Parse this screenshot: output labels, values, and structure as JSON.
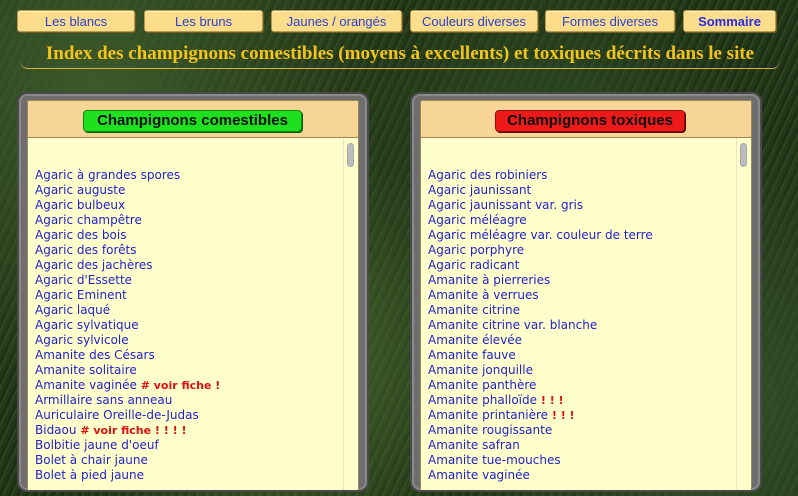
{
  "nav": {
    "tabs": [
      {
        "label": "Les blancs"
      },
      {
        "label": "Les bruns"
      },
      {
        "label": "Jaunes / orangés"
      },
      {
        "label": "Couleurs diverses"
      },
      {
        "label": "Formes diverses"
      },
      {
        "label": "Sommaire"
      }
    ]
  },
  "title": "Index des champignons comestibles (moyens à excellents) et toxiques décrits dans le site",
  "colors": {
    "accent_title": "#f2c418",
    "link": "#2222cc",
    "edible_button": "#1ee01e",
    "toxic_button": "#ee1a1a",
    "warning": "#e01010"
  },
  "edible": {
    "heading": "Champignons comestibles",
    "items": [
      {
        "name": "Agaric à grandes spores",
        "note": ""
      },
      {
        "name": "Agaric auguste",
        "note": ""
      },
      {
        "name": "Agaric bulbeux",
        "note": ""
      },
      {
        "name": "Agaric champêtre",
        "note": ""
      },
      {
        "name": "Agaric des bois",
        "note": ""
      },
      {
        "name": "Agaric des forêts",
        "note": ""
      },
      {
        "name": "Agaric des jachères",
        "note": ""
      },
      {
        "name": "Agaric d'Essette",
        "note": ""
      },
      {
        "name": "Agaric Eminent",
        "note": ""
      },
      {
        "name": "Agaric laqué",
        "note": ""
      },
      {
        "name": "Agaric sylvatique",
        "note": ""
      },
      {
        "name": "Agaric sylvicole",
        "note": ""
      },
      {
        "name": "Amanite des Césars",
        "note": ""
      },
      {
        "name": "Amanite solitaire",
        "note": ""
      },
      {
        "name": "Amanite vaginée",
        "note": "# voir fiche !"
      },
      {
        "name": "Armillaire sans anneau",
        "note": ""
      },
      {
        "name": "Auriculaire Oreille-de-Judas",
        "note": ""
      },
      {
        "name": "Bidaou",
        "note": "# voir fiche !   ! ! !"
      },
      {
        "name": "Bolbitie jaune d'oeuf",
        "note": ""
      },
      {
        "name": "Bolet à chair jaune",
        "note": ""
      },
      {
        "name": "Bolet à pied jaune",
        "note": ""
      }
    ]
  },
  "toxic": {
    "heading": "Champignons toxiques",
    "items": [
      {
        "name": "Agaric des robiniers",
        "note": ""
      },
      {
        "name": "Agaric jaunissant",
        "note": ""
      },
      {
        "name": "Agaric jaunissant var. gris",
        "note": ""
      },
      {
        "name": "Agaric méléagre",
        "note": ""
      },
      {
        "name": "Agaric méléagre var. couleur de terre",
        "note": ""
      },
      {
        "name": "Agaric porphyre",
        "note": ""
      },
      {
        "name": "Agaric radicant",
        "note": ""
      },
      {
        "name": "Amanite à pierreries",
        "note": ""
      },
      {
        "name": "Amanite à verrues",
        "note": ""
      },
      {
        "name": "Amanite citrine",
        "note": ""
      },
      {
        "name": "Amanite citrine var. blanche",
        "note": ""
      },
      {
        "name": "Amanite élevée",
        "note": ""
      },
      {
        "name": "Amanite fauve",
        "note": ""
      },
      {
        "name": "Amanite jonquille",
        "note": ""
      },
      {
        "name": "Amanite panthère",
        "note": ""
      },
      {
        "name": "Amanite phalloïde",
        "note": "! ! !"
      },
      {
        "name": "Amanite printanière",
        "note": "! ! !"
      },
      {
        "name": "Amanite rougissante",
        "note": ""
      },
      {
        "name": "Amanite safran",
        "note": ""
      },
      {
        "name": "Amanite tue-mouches",
        "note": ""
      },
      {
        "name": "Amanite vaginée",
        "note": ""
      }
    ]
  }
}
